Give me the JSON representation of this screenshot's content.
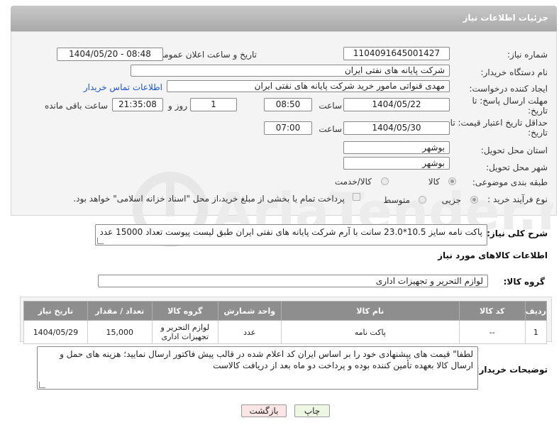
{
  "header": {
    "title": "جزئیات اطلاعات نیاز"
  },
  "form": {
    "need_number": {
      "label": "شماره نیاز:",
      "value": "1104091645001427"
    },
    "announce_datetime": {
      "label": "تاریخ و ساعت اعلان عمومی:",
      "value": "1404/05/20 - 08:48"
    },
    "buyer_org": {
      "label": "نام دستگاه خریدار:",
      "value": "شرکت پایانه های نفتی ایران"
    },
    "requester": {
      "label": "ایجاد کننده درخواست:",
      "value": "مهدی قنواتی مامور خرید شرکت پایانه های نفتی ایران",
      "contact_link": "اطلاعات تماس خریدار"
    },
    "reply_deadline": {
      "label": "مهلت ارسال پاسخ: تا تاریخ:",
      "date": "1404/05/22",
      "time_label": "ساعت",
      "time": "08:50",
      "days": "1",
      "days_label": "روز و",
      "remaining": "21:35:08",
      "remaining_label": "ساعت باقی مانده"
    },
    "price_validity": {
      "label": "حداقل تاریخ اعتبار قیمت: تا تاریخ:",
      "date": "1404/05/30",
      "time_label": "ساعت",
      "time": "07:00"
    },
    "delivery_province": {
      "label": "استان محل تحویل:",
      "value": "بوشهر"
    },
    "delivery_city": {
      "label": "شهر محل تحویل:",
      "value": "بوشهر"
    },
    "category": {
      "label": "طبقه بندی موضوعی:",
      "options": [
        "کالا",
        "کالا/خدمت"
      ],
      "selected": "کالا"
    },
    "purchase_process": {
      "label": "نوع فرآیند خرید :",
      "options": [
        "جزیی",
        "متوسط"
      ],
      "selected": "جزیی",
      "note": "پرداخت تمام یا بخشی از مبلغ خرید،از محل \"اسناد خزانه اسلامی\" خواهد بود."
    }
  },
  "summary": {
    "label": "شرح کلی نیاز:",
    "value": "پاکت نامه سایز 10.5*23.0 سانت با آرم شرکت پایانه های نفتی ایران طبق لیست پیوست تعداد 15000 عدد"
  },
  "goods_section": {
    "title": "اطلاعات کالاهای مورد نیاز",
    "group_label": "گروه کالا:",
    "group_value": "لوازم التحریر و تجهیزات اداری"
  },
  "table": {
    "headers": [
      "ردیف",
      "کد کالا",
      "نام کالا",
      "واحد شمارش",
      "گروه کالا",
      "تعداد / مقدار",
      "تاریخ نیاز"
    ],
    "rows": [
      {
        "row": "1",
        "code": "--",
        "name": "پاکت نامه",
        "unit": "عدد",
        "group": "لوازم التحریر و تجهیزات اداری",
        "qty": "15,000",
        "date": "1404/05/29"
      }
    ]
  },
  "buyer_notes": {
    "label": "توضیحات خریدار:",
    "value": "لطفا\" قیمت های پیشنهادی خود را بر اساس ایران کد اعلام شده در قالب پیش فاکتور ارسال نمایید؛ هزینه های حمل و ارسال کالا بعهده تأمین کننده بوده و پرداخت دو ماه بعد از دریافت کالاست"
  },
  "buttons": {
    "print": "چاپ",
    "back": "بازگشت"
  },
  "colors": {
    "header": "#b1b1b1",
    "link": "#1a56c5",
    "print_btn": "#eef7e4",
    "back_btn": "#fbe5e5"
  }
}
